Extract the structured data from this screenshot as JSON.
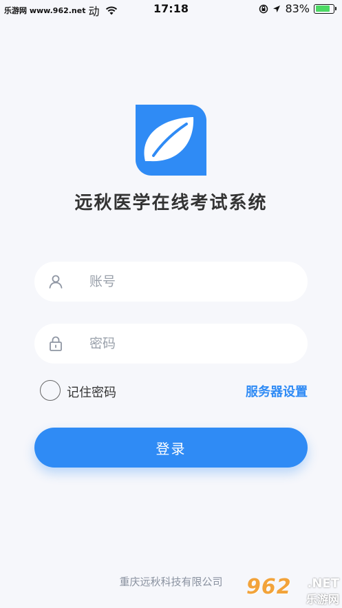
{
  "status_bar": {
    "watermark": "乐游网 www.962.net",
    "carrier": "动",
    "time": "17:18",
    "battery_percent": "83%",
    "battery_level": 0.83
  },
  "app": {
    "title": "远秋医学在线考试系统"
  },
  "form": {
    "account_placeholder": "账号",
    "password_placeholder": "密码",
    "remember_label": "记住密码",
    "server_settings_label": "服务器设置",
    "login_label": "登录"
  },
  "footer": {
    "company": "重庆远秋科技有限公司"
  },
  "watermark": {
    "number": "962",
    "net": ".NET",
    "cn": "乐游网"
  },
  "colors": {
    "accent": "#2f8bf5",
    "background": "#f6f7fb",
    "battery": "#4cd964"
  }
}
